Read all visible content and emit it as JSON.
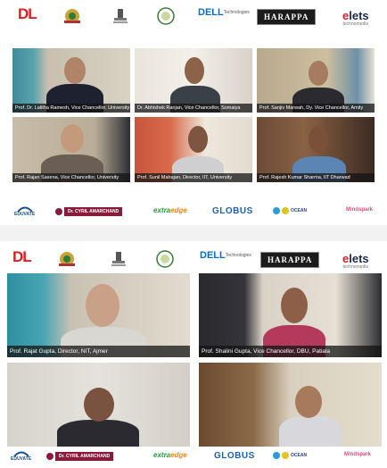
{
  "header_logos": {
    "dl": "DL",
    "dell_brand": "DELL",
    "dell_tagline": "Technologies",
    "harappa": "HARAPPA",
    "elets_e": "e",
    "elets_rest": "lets",
    "elets_tagline": "technomedia"
  },
  "top_panel": {
    "participants": [
      {
        "name": "Prof. Dr. Lalitha Ramesh, Vice Chancellor, University"
      },
      {
        "name": "Dr. Abhishek Ranjan, Vice Chancellor, Somaiya"
      },
      {
        "name": "Prof. Sanjiv Marwah, Dy. Vice Chancellor, Amity"
      },
      {
        "name": "Prof. Rajan Saxena, Vice Chancellor, University"
      },
      {
        "name": "Prof. Sunil Mahajan, Director, IIT, University"
      },
      {
        "name": "Prof. Rajesh Kumar Sharma, IIT Dharwad"
      }
    ]
  },
  "bottom_panel": {
    "participants": [
      {
        "name": "Prof. Rajat Gupta, Director, NIT, Ajmer"
      },
      {
        "name": "Prof. Shalini Gupta, Vice Chancellor, DBU, Patiala"
      },
      {
        "name": ""
      },
      {
        "name": ""
      }
    ]
  },
  "sponsors": {
    "eduvate": "EDUVATE",
    "cyril": "Dr. CYRIL AMARCHAND",
    "extra_a": "extra",
    "extra_b": "edge",
    "globus": "GLOBUS",
    "ocean": "OCEAN",
    "mind": "Mindspark"
  }
}
